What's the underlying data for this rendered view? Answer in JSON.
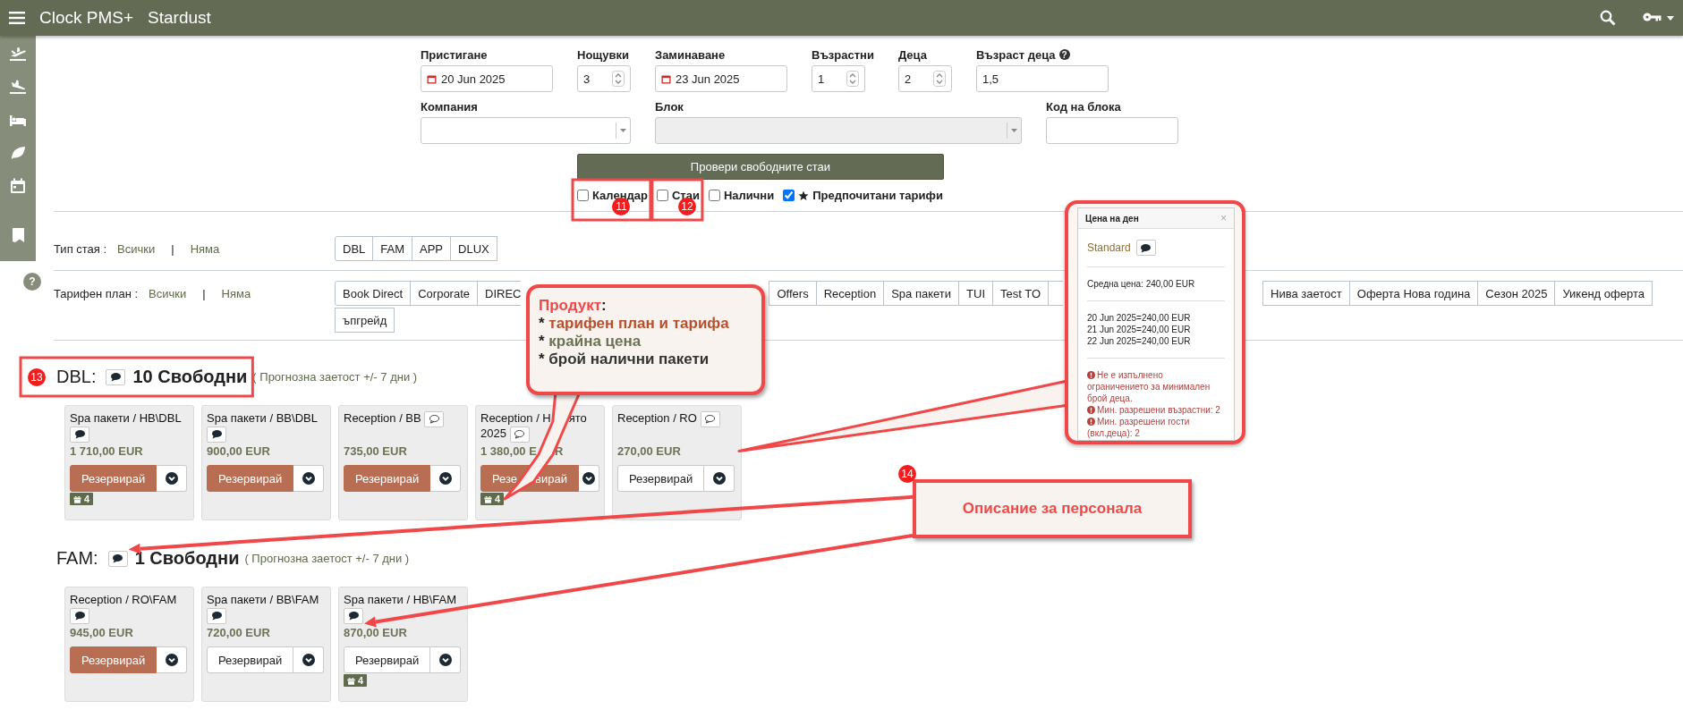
{
  "app": {
    "title": "Clock PMS+",
    "property": "Stardust"
  },
  "sidebar": {
    "help": "?"
  },
  "search_form": {
    "fields": [
      {
        "label": "Пристигане",
        "value": "20 Jun 2025",
        "kind": "date"
      },
      {
        "label": "Нощувки",
        "value": "3",
        "kind": "spinner"
      },
      {
        "label": "Заминаване",
        "value": "23 Jun 2025",
        "kind": "date"
      },
      {
        "label": "Възрастни",
        "value": "1",
        "kind": "spinner"
      },
      {
        "label": "Деца",
        "value": "2",
        "kind": "spinner"
      },
      {
        "label": "Възраст деца",
        "value": "1,5",
        "kind": "text",
        "help": "?"
      }
    ],
    "filters": [
      {
        "label": "Компания",
        "kind": "select",
        "disabled": false
      },
      {
        "label": "Блок",
        "kind": "select",
        "disabled": true
      },
      {
        "label": "Код на блока",
        "kind": "text",
        "disabled": false
      }
    ],
    "submit": "Провери свободните стаи",
    "options": [
      {
        "label": "Календар",
        "checked": false,
        "starred": false,
        "marker": "11"
      },
      {
        "label": "Стаи",
        "checked": false,
        "starred": false,
        "marker": "12"
      },
      {
        "label": "Налични",
        "checked": false,
        "starred": false
      },
      {
        "label": "Предпочитани тарифи",
        "checked": true,
        "starred": true
      }
    ]
  },
  "room_type_filter": {
    "label": "Тип стая :",
    "all": "Всички",
    "separator": "|",
    "none": "Няма",
    "options": [
      {
        "label": "DBL"
      },
      {
        "label": "FAM"
      },
      {
        "label": "APP"
      },
      {
        "label": "DLUX"
      }
    ]
  },
  "rate_plan_filter": {
    "label": "Тарифен план :",
    "all": "Всички",
    "separator": "|",
    "none": "Няма",
    "options": [
      {
        "label": "Book Direct"
      },
      {
        "label": "Corporate"
      },
      {
        "label": "DIREC",
        "kind": "covered"
      },
      {
        "label": "Offers"
      },
      {
        "label": "Reception"
      },
      {
        "label": "Spa пакети"
      },
      {
        "label": "TUI"
      },
      {
        "label": "Test TO"
      },
      {
        "kind": "covered"
      },
      {
        "label": "Нива заетост"
      },
      {
        "label": "Оферта Нова година"
      },
      {
        "label": "Сезон 2025"
      },
      {
        "label": "Уикенд оферта"
      },
      {
        "label": "ъпгрейд"
      }
    ]
  },
  "sections": [
    {
      "room": "DBL:",
      "note_filled": true,
      "available": "10 Свободни",
      "forecast": "( Прогнозна заетост +/- 7 дни )",
      "marker": "13",
      "kind": "plain",
      "cards": [
        {
          "title": [
            "Spa пакети / HB\\DBL"
          ],
          "note_filled": true,
          "price": [
            "1 710,00 EUR"
          ],
          "book": [
            "Резервирай"
          ],
          "primary": true,
          "packages": "4",
          "kind": "plain"
        },
        {
          "title": [
            "Spa пакети / BB\\DBL"
          ],
          "note_filled": true,
          "price": [
            "900,00 EUR"
          ],
          "book": [
            "Резервирай"
          ],
          "primary": true,
          "kind": "plain"
        },
        {
          "title": [
            "Reception / BB"
          ],
          "note_filled": false,
          "price": [
            "735,00 EUR"
          ],
          "book": [
            "Резервирай"
          ],
          "primary": true,
          "kind": "plain"
        },
        {
          "title": [
            "Reception / Н",
            "ято 2025"
          ],
          "note_filled": false,
          "price": [
            "1 380,00 E",
            "R"
          ],
          "book": [
            "Резе",
            "вирай"
          ],
          "primary": true,
          "packages": "4",
          "kind": "tail_target"
        },
        {
          "title": [
            "Reception / RO"
          ],
          "note_filled": false,
          "price": [
            "270,00 EUR"
          ],
          "book": [
            "Резервирай"
          ],
          "primary": false,
          "kind": "wedge_target"
        }
      ]
    },
    {
      "room": "FAM:",
      "note_filled": true,
      "available": "1 Свободни",
      "forecast": "( Прогнозна заетост +/- 7 дни )",
      "kind": "arrow_target",
      "cards": [
        {
          "title": [
            "Reception / RO\\FAM"
          ],
          "note_filled": true,
          "price": [
            "945,00 EUR"
          ],
          "book": [
            "Резервирай"
          ],
          "primary": true,
          "kind": "plain"
        },
        {
          "title": [
            "Spa пакети / BB\\FAM"
          ],
          "note_filled": true,
          "price": [
            "720,00 EUR"
          ],
          "book": [
            "Резервирай"
          ],
          "primary": false,
          "kind": "plain"
        },
        {
          "title": [
            "Spa пакети / HB\\FAM"
          ],
          "note_filled": true,
          "price": [
            "870,00 EUR"
          ],
          "book": [
            "Резервирай"
          ],
          "primary": false,
          "packages": "4",
          "kind": "arrow_target"
        }
      ]
    }
  ],
  "price_popup": {
    "title": "Цена на ден",
    "close": "×",
    "rate": "Standard",
    "rate_note_filled": true,
    "average": "Средна цена: 240,00 EUR",
    "nights": [
      "20 Jun 2025=240,00 EUR",
      "21 Jun 2025=240,00 EUR",
      "22 Jun 2025=240,00 EUR"
    ],
    "warnings": [
      "Не е изпълнено ограничението за минимален брой деца.",
      "Мин. разрешени възрастни: 2",
      "Мин. разрешени гости (вкл.деца): 2"
    ]
  },
  "callouts": [
    {
      "kind": "product",
      "heading": "Продукт",
      "heading_suffix": ":",
      "lines": [
        {
          "marker": "*",
          "text": "тарифен план и тарифа",
          "kind": "rate"
        },
        {
          "marker": "*",
          "text": "крайна цена",
          "kind": "price"
        },
        {
          "marker": "*",
          "text": "брой налични пакети",
          "kind": "count"
        }
      ]
    },
    {
      "kind": "staff_note",
      "marker": "14",
      "text": "Описание за персонала"
    }
  ]
}
